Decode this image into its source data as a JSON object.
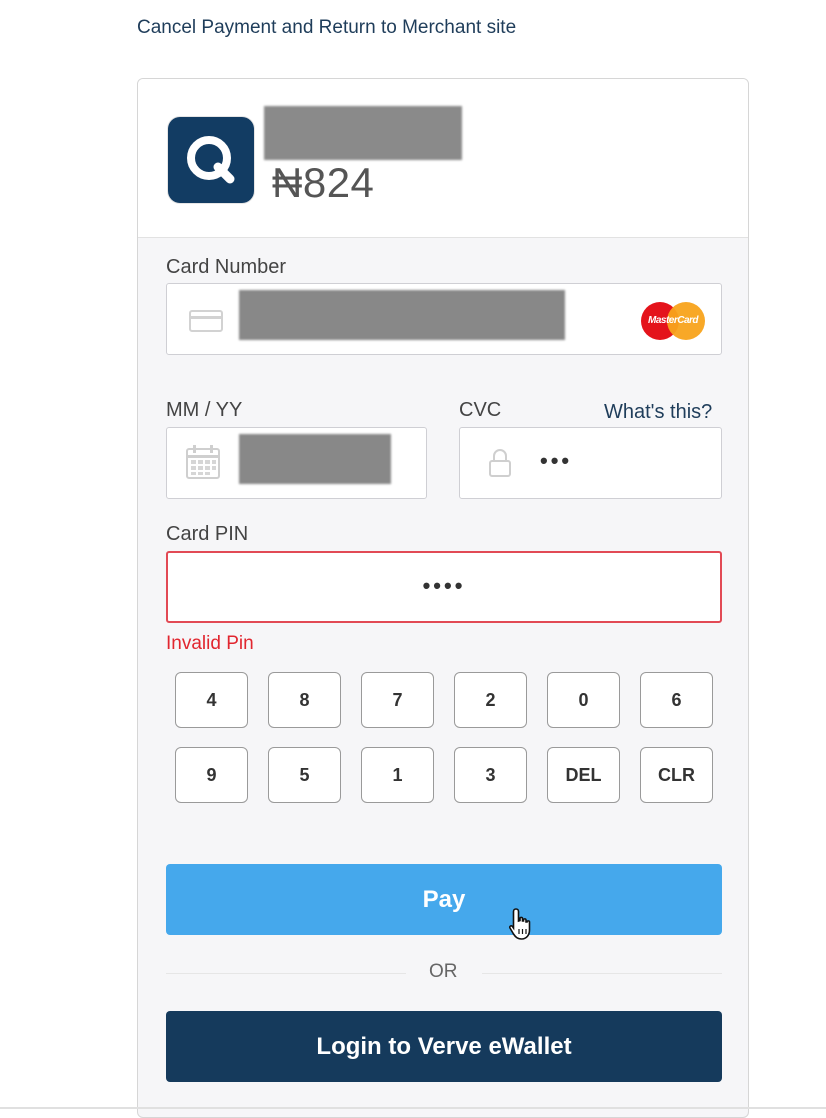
{
  "cancel_link": "Cancel Payment and Return to Merchant site",
  "merchant": {
    "amount": "₦824",
    "logo_icon": "q-logo-icon"
  },
  "card_number": {
    "label": "Card Number",
    "brand": "MasterCard"
  },
  "expiry": {
    "label": "MM / YY"
  },
  "cvc": {
    "label": "CVC",
    "help_link": "What's this?",
    "masked_value": "•••"
  },
  "pin": {
    "label": "Card PIN",
    "masked_value": "••••",
    "error": "Invalid Pin"
  },
  "keypad": {
    "row1": [
      "4",
      "8",
      "7",
      "2",
      "0",
      "6"
    ],
    "row2": [
      "9",
      "5",
      "1",
      "3",
      "DEL",
      "CLR"
    ]
  },
  "pay_button": "Pay",
  "or_text": "OR",
  "verve_button": "Login to Verve eWallet",
  "colors": {
    "accent": "#45a8ec",
    "navy": "#153a5c",
    "error": "#e1262f"
  }
}
